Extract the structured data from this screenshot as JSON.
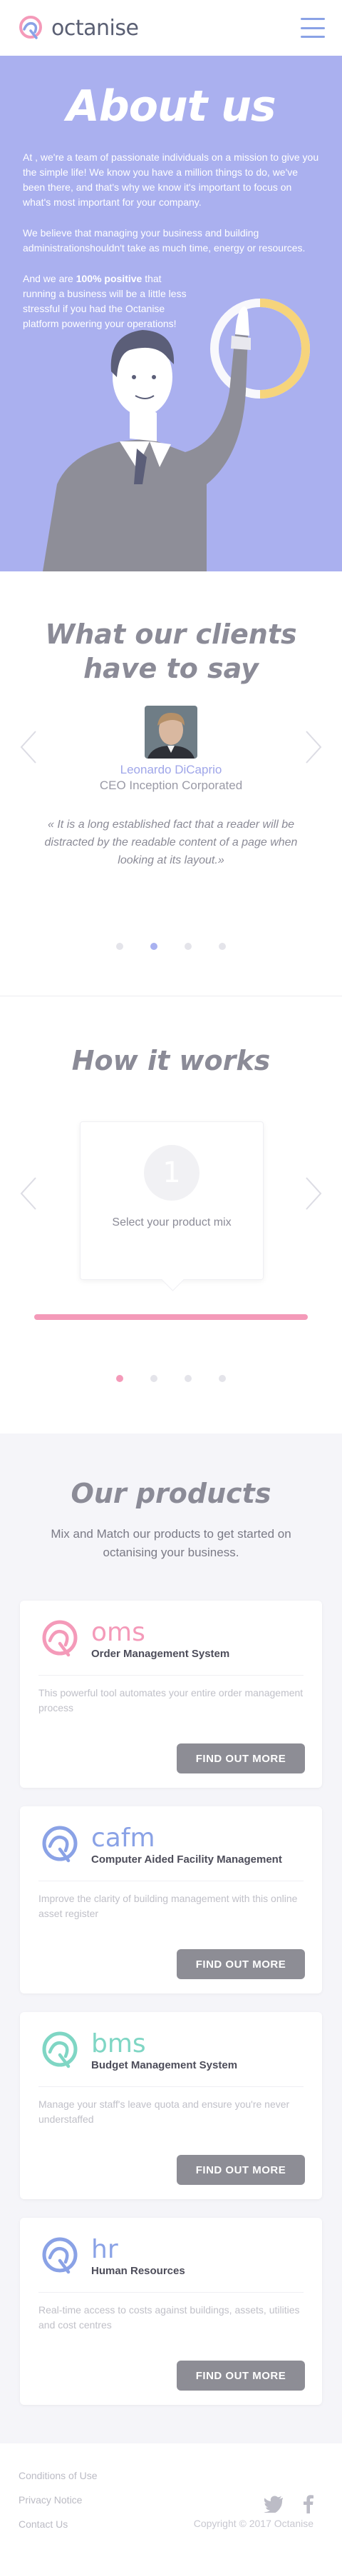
{
  "brand": {
    "name": "octanise"
  },
  "about": {
    "title": "About us",
    "p1": "At , we're a team of passionate individuals on a mission to give you the simple life! We know you have a million things to do, we've been there, and that's why we know it's important to focus on what's most important for your company.",
    "p2": "We believe that managing your business and building administrationshouldn't take as much time, energy or resources.",
    "p3_prefix": "And we are ",
    "p3_bold": "100% positive",
    "p3_suffix": " that running a business will be a little less stressful if you had the Octanise platform powering your operations!"
  },
  "testimonials": {
    "title_line1": "What our clients",
    "title_line2": "have to say",
    "name": "Leonardo DiCaprio",
    "role": "CEO Inception Corporated",
    "quote_open": "«",
    "quote": "It is a long established fact that a reader will be distracted by the readable content of a page when looking at its layout.",
    "quote_close": "»",
    "active_index": 1,
    "dot_count": 4
  },
  "how": {
    "title": "How it works",
    "step_number": "1",
    "step_label": "Select your product mix",
    "active_index": 0,
    "dot_count": 4
  },
  "products": {
    "title": "Our products",
    "subtitle": "Mix and Match our products to get started on octanising your business.",
    "items": [
      {
        "brand": "oms",
        "full": "Order Management System",
        "desc": "This powerful tool automates your entire order management process",
        "button": "FIND OUT MORE",
        "color": "#f49ab9"
      },
      {
        "brand": "cafm",
        "full": "Computer Aided Facility Management",
        "desc": "Improve the clarity of building management with this online asset register",
        "button": "FIND OUT MORE",
        "color": "#8aa2e6"
      },
      {
        "brand": "bms",
        "full": "Budget Management System",
        "desc": "Manage your staff's leave quota and ensure you're never understaffed",
        "button": "FIND OUT MORE",
        "color": "#7fd6c4"
      },
      {
        "brand": "hr",
        "full": "Human Resources",
        "desc": "Real-time access to costs against buildings, assets, utilities and cost centres",
        "button": "FIND OUT MORE",
        "color": "#8aa2e6"
      }
    ]
  },
  "footer": {
    "links": [
      "Conditions of Use",
      "Privacy Notice",
      "Contact Us"
    ],
    "copyright": "Copyright © 2017 Octanise"
  },
  "colors": {
    "about_bg": "#aab0ef",
    "accent_pink": "#f49ab9",
    "accent_blue": "#8aa2e6",
    "button": "#8d8d95"
  }
}
